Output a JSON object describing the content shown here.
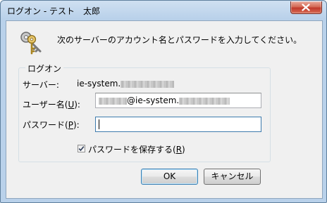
{
  "window": {
    "title": "ログオン - テスト　太郎"
  },
  "dialog": {
    "instruction": "次のサーバーのアカウント名とパスワードを入力してください。",
    "group_title": "ログオン",
    "server_label": "サーバー:",
    "server_value_prefix": "ie-system.",
    "username_label_prefix": "ユーザー名(",
    "username_label_access_key": "U",
    "username_label_suffix": "):",
    "username_value_suffix": "@ie-system.",
    "password_label_prefix": "パスワード(",
    "password_label_access_key": "P",
    "password_label_suffix": "):",
    "password_value": "",
    "save_password_prefix": "パスワードを保存する(",
    "save_password_access_key": "R",
    "save_password_suffix": ")",
    "save_password_checked": true,
    "ok_label": "OK",
    "cancel_label": "キャンセル"
  },
  "icons": {
    "keys": "keys-icon",
    "close": "close-icon",
    "check": "checkmark-icon"
  }
}
